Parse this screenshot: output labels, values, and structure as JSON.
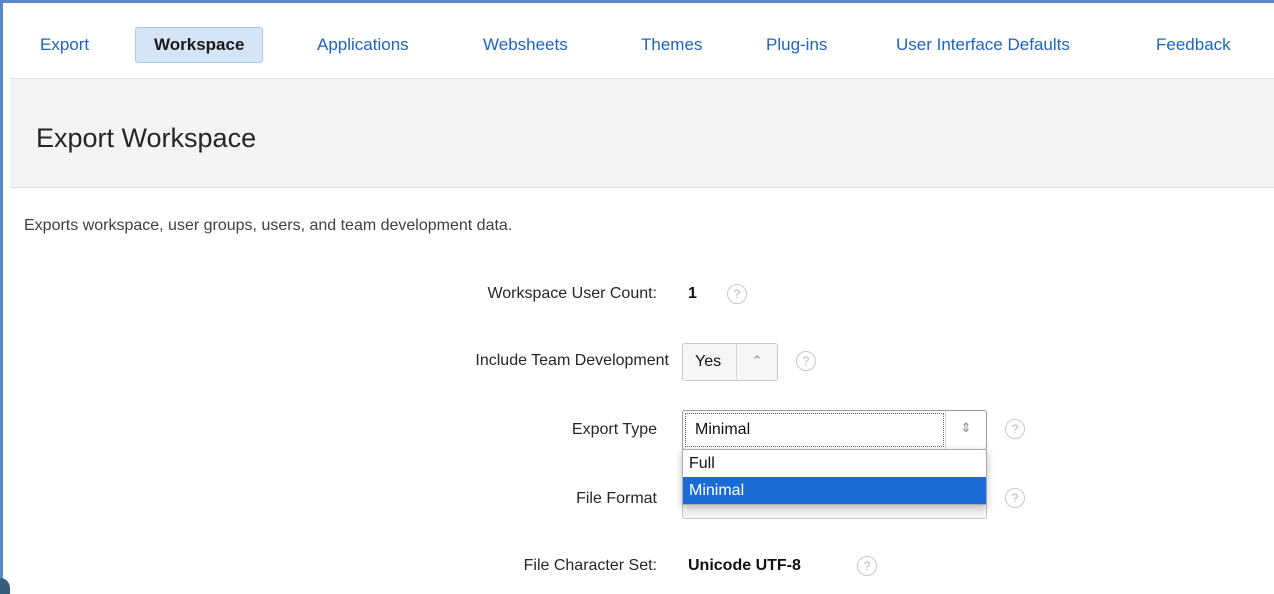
{
  "tabs": [
    {
      "label": "Export",
      "active": false
    },
    {
      "label": "Workspace",
      "active": true
    },
    {
      "label": "Applications",
      "active": false
    },
    {
      "label": "Websheets",
      "active": false
    },
    {
      "label": "Themes",
      "active": false
    },
    {
      "label": "Plug-ins",
      "active": false
    },
    {
      "label": "User Interface Defaults",
      "active": false
    },
    {
      "label": "Feedback",
      "active": false
    }
  ],
  "page_title": "Export Workspace",
  "description": "Exports workspace, user groups, users, and team development data.",
  "form": {
    "user_count": {
      "label": "Workspace User Count:",
      "value": "1",
      "help": "?"
    },
    "team_dev": {
      "label": "Include Team Development",
      "value": "Yes",
      "help": "?"
    },
    "export_type": {
      "label": "Export Type",
      "value": "Minimal",
      "options": [
        "Full",
        "Minimal"
      ],
      "help": "?"
    },
    "file_format": {
      "label": "File Format",
      "help": "?"
    },
    "charset": {
      "label": "File Character Set:",
      "value": "Unicode UTF-8",
      "help": "?"
    }
  },
  "icons": {
    "chevron": "up-down-chevron-icon",
    "help": "question-circle-icon"
  },
  "colors": {
    "accent": "#1f64b8",
    "active_tab_bg": "#d4e5f7",
    "selected_option": "#1c6bd4",
    "header_band": "#f4f4f4"
  }
}
